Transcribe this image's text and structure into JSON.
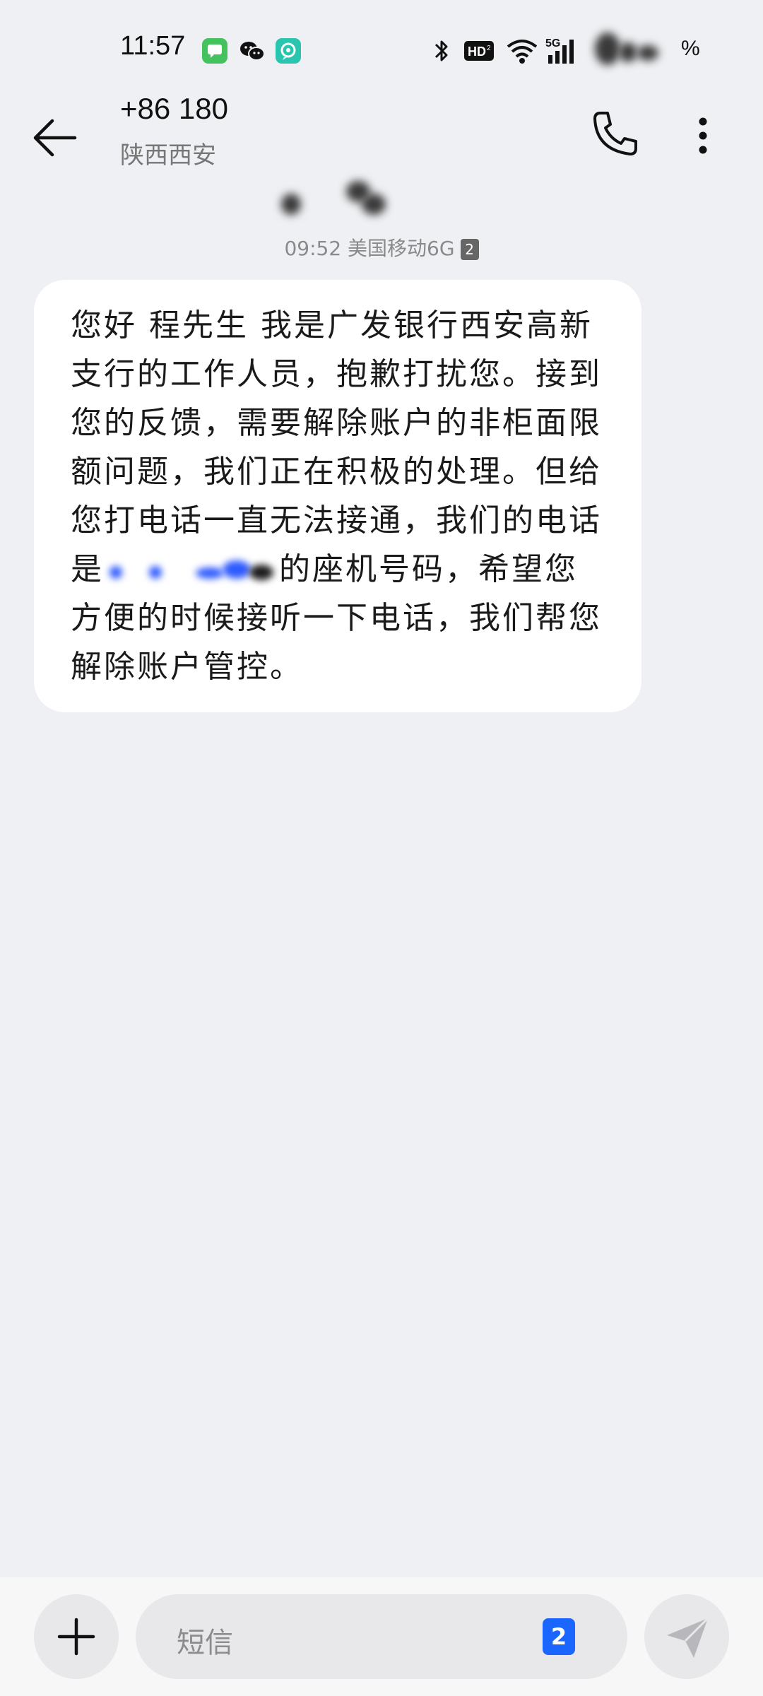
{
  "status_bar": {
    "time": "11:57",
    "network": "5G",
    "hd": "HD",
    "battery_suffix": "%"
  },
  "header": {
    "contact_number": "+86 180",
    "contact_location": "陕西西安"
  },
  "thread": {
    "timestamp_time": "09:52",
    "timestamp_carrier": "美国移动6G",
    "sim_badge": "2",
    "message_part1": "您好 程先生 我是广发银行西安高新支行的工作人员，抱歉打扰您。接到您的反馈，需要解除账户的非柜面限额问题，我们正在积极的处理。但给您打电话一直无法接通，我们的电话是",
    "message_part2": "的座机号码，希望您方便的时候接听一下电话，我们帮您解除账户管控。"
  },
  "composer": {
    "placeholder": "短信",
    "sim_label": "2"
  },
  "colors": {
    "background": "#eff0f3",
    "bubble": "#ffffff",
    "accent": "#1a66ff"
  }
}
